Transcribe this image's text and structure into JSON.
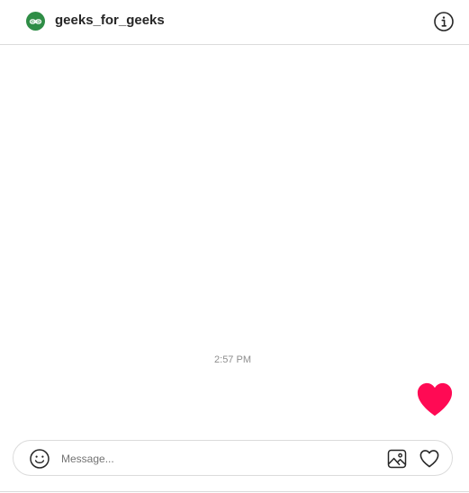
{
  "header": {
    "username": "geeks_for_geeks",
    "avatar_icon": "gfg-logo-icon",
    "avatar_color": "#2f8d46",
    "info_icon": "info-circle-icon"
  },
  "thread": {
    "timestamp": "2:57 PM",
    "messages": [
      {
        "type": "like",
        "icon": "heart-filled-icon",
        "color": "#ff0a54"
      }
    ]
  },
  "composer": {
    "placeholder": "Message...",
    "emoji_icon": "emoji-icon",
    "image_icon": "image-icon",
    "like_icon": "heart-outline-icon"
  }
}
